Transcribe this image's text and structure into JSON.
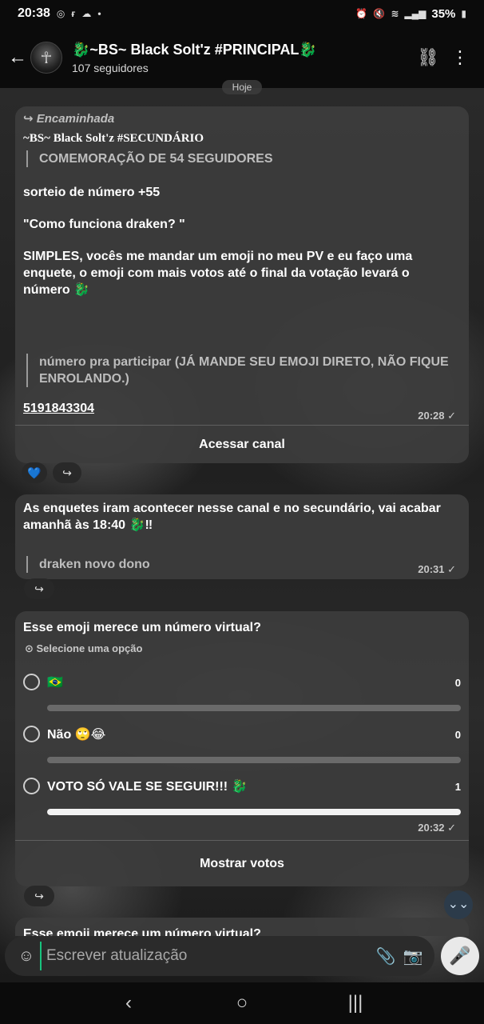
{
  "status_bar": {
    "time": "20:38",
    "battery": "35%",
    "left_icons": [
      "whatsapp-icon",
      "f-icon",
      "cloud-icon",
      "dot-icon"
    ],
    "right_icons": [
      "alarm-icon",
      "mute-icon",
      "wifi-icon",
      "signal-icon"
    ]
  },
  "header": {
    "title": "🐉~BS~ Black Solt'z  #PRINCIPAL🐉",
    "subtitle": "107 seguidores",
    "date_chip": "Hoje"
  },
  "messages": {
    "forwarded": {
      "label": "Encaminhada",
      "source": "~BS~ Black Solt'z #SECUNDÁRIO",
      "quote": "COMEMORAÇÃO DE 54 SEGUIDORES",
      "line1": "sorteio de número +55",
      "line2": "\"Como funciona draken? \"",
      "line3": "SIMPLES, vocês me mandar um emoji no meu PV e eu faço uma enquete, o emoji com mais votos até o final da votação levará o número",
      "line3_emoji": "🐉",
      "quote2": "número pra participar (JÁ MANDE SEU EMOJI DIRETO, NÃO FIQUE ENROLANDO.)",
      "phone": "5191843304",
      "time": "20:28 ✓",
      "action": "Acessar canal",
      "reaction": "💙",
      "share": "↪"
    },
    "second": {
      "text": "As enquetes iram acontecer nesse canal e no secundário, vai acabar amanhã às 18:40 🐉‼",
      "quote": "draken novo dono",
      "time": "20:31 ✓",
      "share": "↪"
    },
    "poll": {
      "question": "Esse emoji merece um número virtual?",
      "hint": "Selecione uma opção",
      "options": [
        {
          "label": "🇧🇷",
          "count": "0",
          "fraction": 0
        },
        {
          "label": "Não 🙄😂",
          "count": "0",
          "fraction": 0
        },
        {
          "label": "VOTO SÓ VALE SE SEGUIR!!! 🐉",
          "count": "1",
          "fraction": 1
        }
      ],
      "time": "20:32 ✓",
      "action": "Mostrar votos",
      "share": "↪"
    },
    "next_partial": "Esse emoji merece um número virtual?"
  },
  "composer": {
    "placeholder": "Escrever atualização"
  },
  "colors": {
    "accent": "#18c37e",
    "bubble": "#3c3c3c",
    "background": "#0b0b0b"
  }
}
